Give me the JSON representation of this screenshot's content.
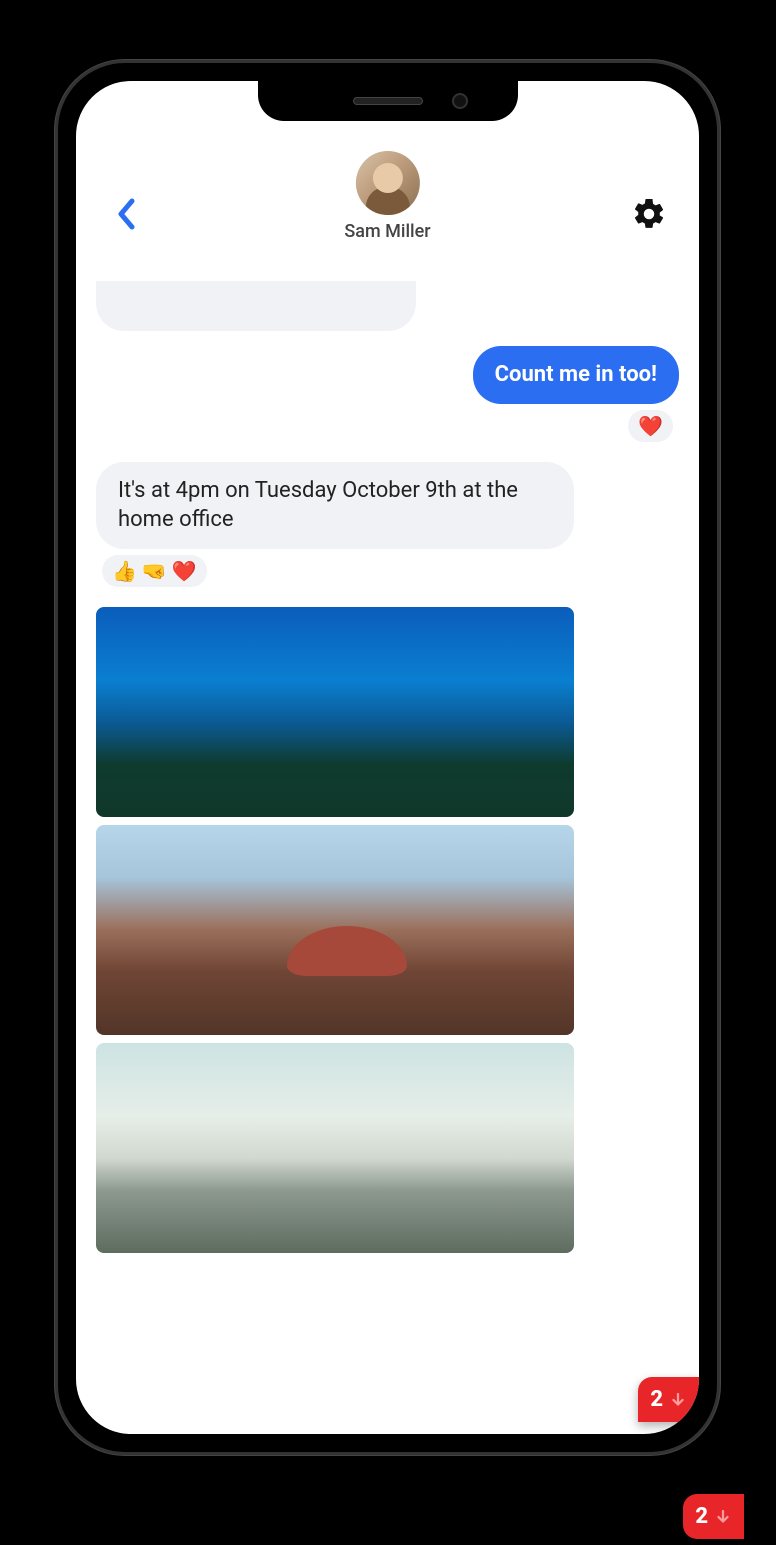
{
  "header": {
    "contact_name": "Sam Miller"
  },
  "messages": {
    "outgoing1_text": "Count me in too!",
    "outgoing1_reaction": "❤️",
    "incoming1_text": "It's at 4pm on Tuesday October 9th at the home office",
    "incoming1_reactions": "👍 🤜 ❤️"
  },
  "images": {
    "img1_name": "underwater-photo",
    "img2_name": "aerial-landscape-photo",
    "img3_name": "city-mountains-photo"
  },
  "badge": {
    "count": "2"
  }
}
